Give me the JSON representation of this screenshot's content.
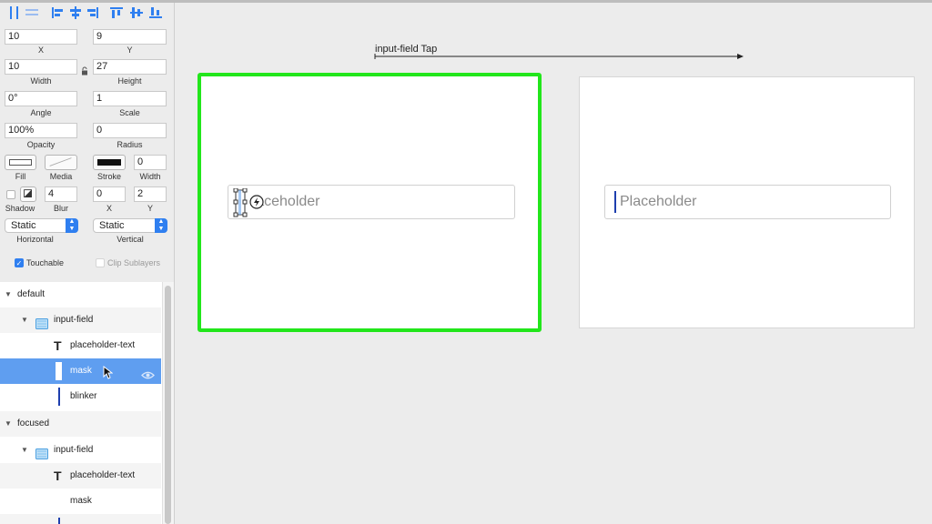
{
  "inspector": {
    "align_icons": [
      "align-horizontal-icon",
      "distribute-icon",
      "align-left-icon",
      "align-center-icon",
      "align-right-icon",
      "align-top-icon",
      "align-middle-icon",
      "align-bottom-icon"
    ],
    "x": {
      "value": "10",
      "label": "X"
    },
    "y": {
      "value": "9",
      "label": "Y"
    },
    "width": {
      "value": "10",
      "label": "Width"
    },
    "height": {
      "value": "27",
      "label": "Height"
    },
    "angle": {
      "value": "0°",
      "label": "Angle"
    },
    "scale": {
      "value": "1",
      "label": "Scale"
    },
    "opacity": {
      "value": "100%",
      "label": "Opacity"
    },
    "radius": {
      "value": "0",
      "label": "Radius"
    },
    "fill_label": "Fill",
    "media_label": "Media",
    "stroke_label": "Stroke",
    "stroke_width": {
      "value": "0",
      "label": "Width"
    },
    "shadow_label": "Shadow",
    "blur": {
      "value": "4",
      "label": "Blur"
    },
    "shadow_x": {
      "value": "0",
      "label": "X"
    },
    "shadow_y": {
      "value": "2",
      "label": "Y"
    },
    "horizontal": {
      "value": "Static",
      "label": "Horizontal"
    },
    "vertical": {
      "value": "Static",
      "label": "Vertical"
    },
    "touchable": {
      "label": "Touchable",
      "checked": true
    },
    "clip_sublayers": {
      "label": "Clip Sublayers",
      "checked": false
    }
  },
  "layers": [
    {
      "label": "default"
    },
    {
      "label": "input-field"
    },
    {
      "label": "placeholder-text"
    },
    {
      "label": "mask"
    },
    {
      "label": "blinker"
    },
    {
      "label": "focused"
    },
    {
      "label": "input-field"
    },
    {
      "label": "placeholder-text"
    },
    {
      "label": "mask"
    }
  ],
  "canvas": {
    "transition_label": "input-field Tap",
    "left_placeholder": "Placeholder",
    "left_placeholder_visible": "Placeholder",
    "right_placeholder": "Placeholder",
    "selection_color": "#22e61b",
    "caret_color": "#1e3fae"
  }
}
